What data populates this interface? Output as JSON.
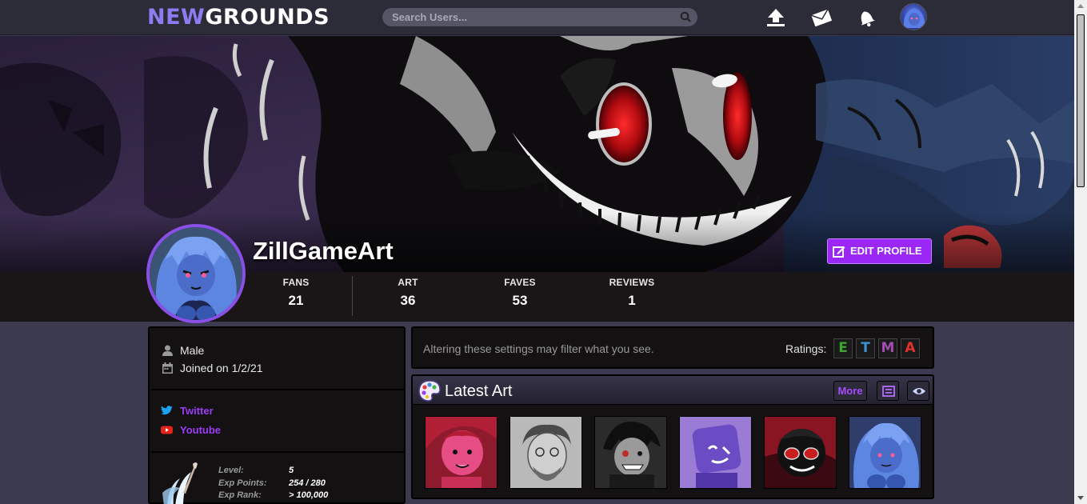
{
  "header": {
    "logo_part1": "NEW",
    "logo_part2": "GROUNDS",
    "search_placeholder": "Search Users...",
    "icons": [
      "upload-icon",
      "mail-icon",
      "bell-icon",
      "user-avatar"
    ]
  },
  "profile": {
    "username": "ZillGameArt",
    "edit_label": "EDIT PROFILE",
    "stats": [
      {
        "label": "FANS",
        "value": "21"
      },
      {
        "label": "ART",
        "value": "36"
      },
      {
        "label": "FAVES",
        "value": "53"
      },
      {
        "label": "REVIEWS",
        "value": "1"
      }
    ]
  },
  "sidebar": {
    "gender": "Male",
    "joined": "Joined on 1/2/21",
    "links": [
      {
        "label": "Twitter",
        "icon": "twitter-icon"
      },
      {
        "label": "Youtube",
        "icon": "youtube-icon"
      }
    ],
    "level": {
      "labels": [
        "Level:",
        "Exp Points:",
        "Exp Rank:"
      ],
      "values": [
        "5",
        "254 / 280",
        "> 100,000"
      ]
    }
  },
  "filter": {
    "message": "Altering these settings may filter what you see.",
    "ratings_label": "Ratings:",
    "ratings": [
      {
        "letter": "E",
        "color": "#3fa52f"
      },
      {
        "letter": "T",
        "color": "#3d92d3"
      },
      {
        "letter": "M",
        "color": "#a34db5"
      },
      {
        "letter": "A",
        "color": "#e0332e"
      }
    ]
  },
  "latest_art": {
    "title": "Latest Art",
    "more_label": "More"
  },
  "colors": {
    "accent": "#9a27f5",
    "link": "#9b3cf5",
    "logo_new": "#8c7cf2"
  }
}
